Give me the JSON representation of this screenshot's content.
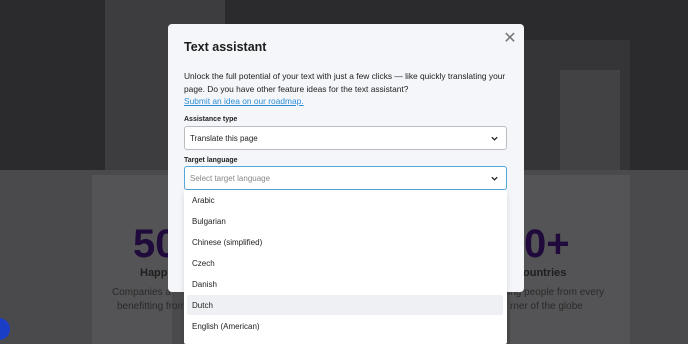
{
  "background": {
    "stat_left": "50",
    "stat_right": "0+",
    "sub_left": "Happ",
    "sub_right": "ountries",
    "text_left_1": "Companies a",
    "text_left_2": "benefitting from",
    "text_right_1": "ing people from every",
    "text_right_2": "rner of the globe"
  },
  "modal": {
    "title": "Text assistant",
    "close_glyph": "✕",
    "description": "Unlock the full potential of your text with just a few clicks — like quickly translating your page. Do you have other feature ideas for the text assistant?",
    "link_text": "Submit an idea on our roadmap.",
    "assistance_type": {
      "label": "Assistance type",
      "value": "Translate this page"
    },
    "target_language": {
      "label": "Target language",
      "placeholder": "Select target language"
    }
  },
  "dropdown": {
    "options": [
      "Arabic",
      "Bulgarian",
      "Chinese (simplified)",
      "Czech",
      "Danish",
      "Dutch",
      "English (American)"
    ],
    "hovered_index": 5
  },
  "colors": {
    "link": "#2b8fd6",
    "focus_border": "#54a8d8",
    "stat_purple": "#1f0a3b"
  }
}
